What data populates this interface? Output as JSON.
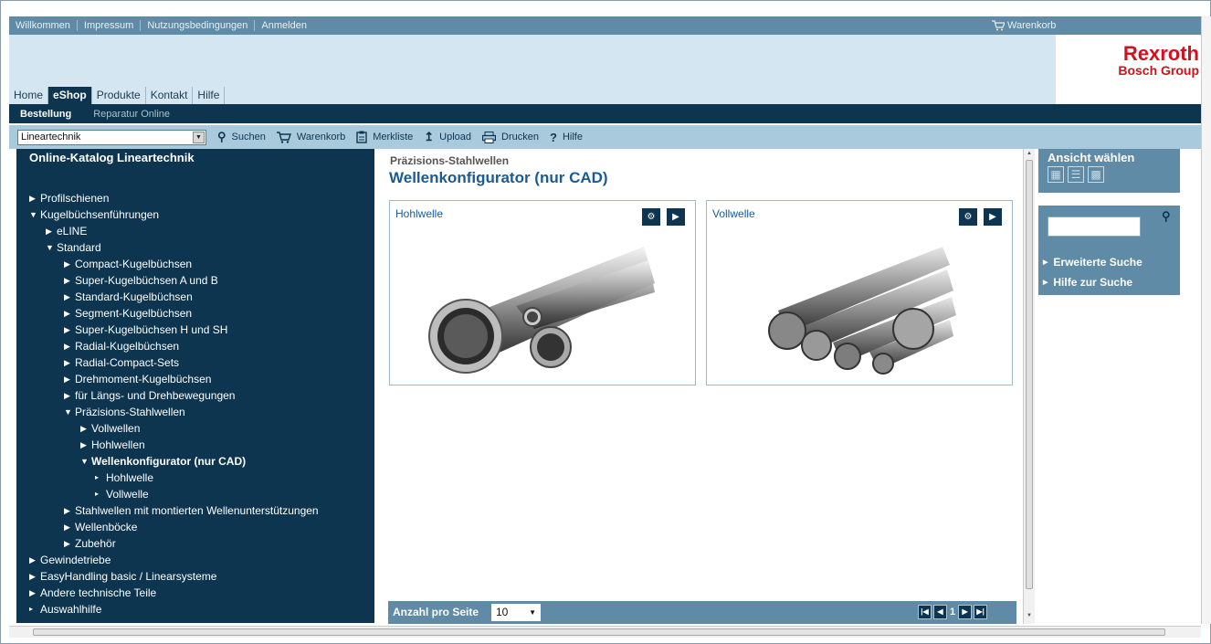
{
  "topbar": {
    "links": [
      "Willkommen",
      "Impressum",
      "Nutzungsbedingungen",
      "Anmelden"
    ],
    "cart_label": "Warenkorb"
  },
  "logo": {
    "name": "Rexroth",
    "sub": "Bosch Group",
    "color": "#d60f1d"
  },
  "nav": {
    "tabs": [
      {
        "label": "Home",
        "active": false
      },
      {
        "label": "eShop",
        "active": true
      },
      {
        "label": "Produkte",
        "active": false
      },
      {
        "label": "Kontakt",
        "active": false
      },
      {
        "label": "Hilfe",
        "active": false
      }
    ]
  },
  "subnav": {
    "items": [
      {
        "label": "Bestellung",
        "active": true
      },
      {
        "label": "Reparatur Online",
        "active": false
      }
    ]
  },
  "toolbar": {
    "select_value": "Lineartechnik",
    "items": [
      {
        "icon": "search-icon",
        "label": "Suchen"
      },
      {
        "icon": "cart-icon",
        "label": "Warenkorb"
      },
      {
        "icon": "clipboard-icon",
        "label": "Merkliste"
      },
      {
        "icon": "upload-icon",
        "label": "Upload"
      },
      {
        "icon": "print-icon",
        "label": "Drucken"
      },
      {
        "icon": "help-icon",
        "label": "Hilfe"
      }
    ]
  },
  "catalog": {
    "title": "Online-Katalog Lineartechnik",
    "tree": [
      {
        "label": "Profilschienen",
        "level": 0,
        "state": "collapsed"
      },
      {
        "label": "Kugelbüchsenführungen",
        "level": 0,
        "state": "expanded"
      },
      {
        "label": "eLINE",
        "level": 1,
        "state": "collapsed"
      },
      {
        "label": "Standard",
        "level": 1,
        "state": "expanded"
      },
      {
        "label": "Compact-Kugelbüchsen",
        "level": 2,
        "state": "collapsed"
      },
      {
        "label": "Super-Kugelbüchsen A und B",
        "level": 2,
        "state": "collapsed"
      },
      {
        "label": "Standard-Kugelbüchsen",
        "level": 2,
        "state": "collapsed"
      },
      {
        "label": "Segment-Kugelbüchsen",
        "level": 2,
        "state": "collapsed"
      },
      {
        "label": "Super-Kugelbüchsen H und SH",
        "level": 2,
        "state": "collapsed"
      },
      {
        "label": "Radial-Kugelbüchsen",
        "level": 2,
        "state": "collapsed"
      },
      {
        "label": "Radial-Compact-Sets",
        "level": 2,
        "state": "collapsed"
      },
      {
        "label": "Drehmoment-Kugelbüchsen",
        "level": 2,
        "state": "collapsed"
      },
      {
        "label": "für Längs- und Drehbewegungen",
        "level": 2,
        "state": "collapsed"
      },
      {
        "label": "Präzisions-Stahlwellen",
        "level": 2,
        "state": "expanded"
      },
      {
        "label": "Vollwellen",
        "level": 3,
        "state": "collapsed"
      },
      {
        "label": "Hohlwellen",
        "level": 3,
        "state": "collapsed"
      },
      {
        "label": "Wellenkonfigurator (nur CAD)",
        "level": 3,
        "state": "expanded",
        "selected": true
      },
      {
        "label": "Hohlwelle",
        "level": 4,
        "state": "leaf"
      },
      {
        "label": "Vollwelle",
        "level": 4,
        "state": "leaf"
      },
      {
        "label": "Stahlwellen mit montierten Wellenunterstützungen",
        "level": 2,
        "state": "collapsed"
      },
      {
        "label": "Wellenböcke",
        "level": 2,
        "state": "collapsed"
      },
      {
        "label": "Zubehör",
        "level": 2,
        "state": "collapsed"
      },
      {
        "label": "Gewindetriebe",
        "level": 0,
        "state": "collapsed"
      },
      {
        "label": "EasyHandling basic / Linearsysteme",
        "level": 0,
        "state": "collapsed"
      },
      {
        "label": "Andere technische Teile",
        "level": 0,
        "state": "collapsed"
      },
      {
        "label": "Auswahlhilfe",
        "level": 0,
        "state": "leaf"
      }
    ]
  },
  "content": {
    "breadcrumb": "Präzisions-Stahlwellen",
    "title": "Wellenkonfigurator (nur CAD)",
    "cards": [
      {
        "name": "Hohlwelle",
        "image": "hollow-shafts-image"
      },
      {
        "name": "Vollwelle",
        "image": "solid-shafts-image"
      }
    ],
    "pager": {
      "label": "Anzahl pro Seite",
      "per_page": "10",
      "page": "1"
    }
  },
  "right": {
    "view_title": "Ansicht wählen",
    "links": [
      "Erweiterte Suche",
      "Hilfe zur Suche"
    ]
  }
}
